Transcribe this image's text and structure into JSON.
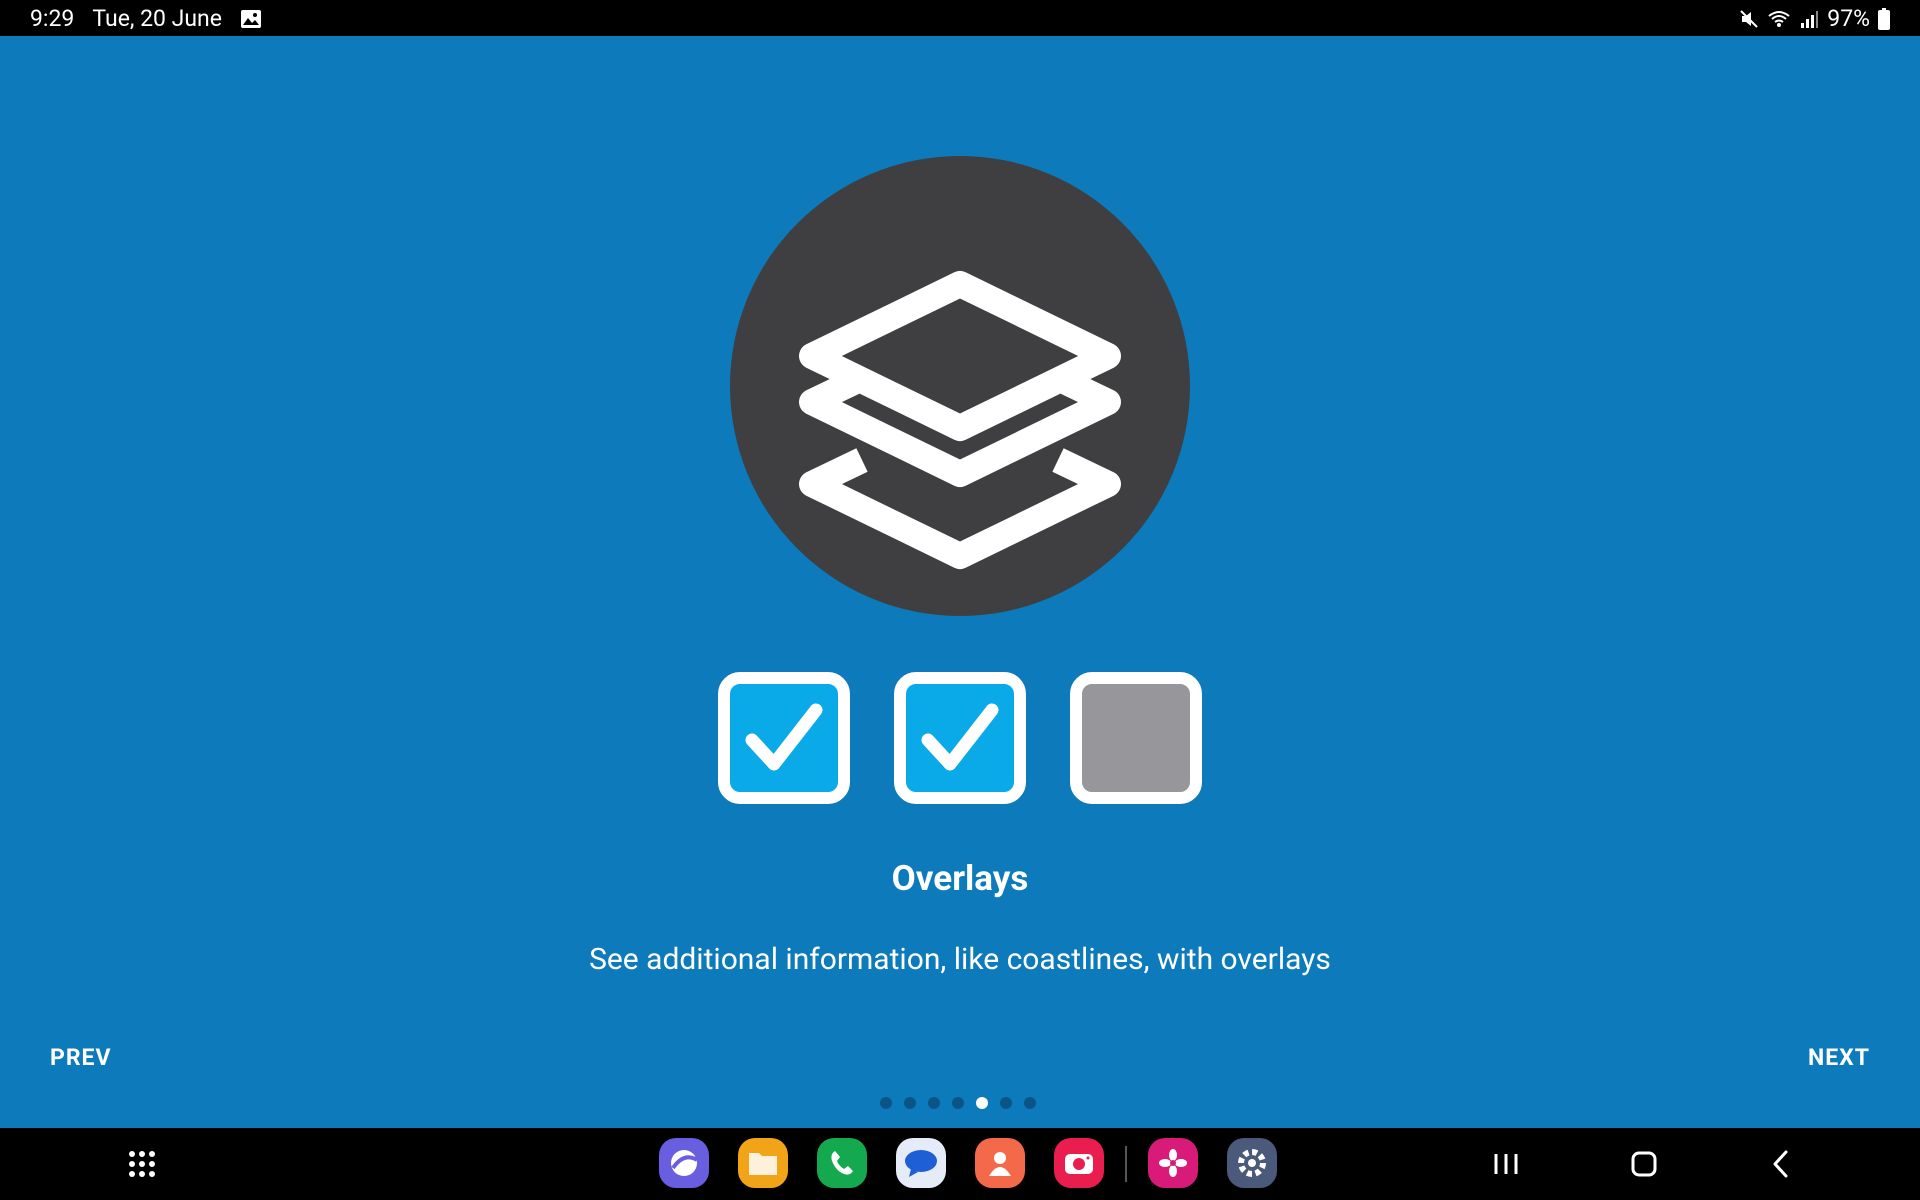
{
  "status_bar": {
    "time": "9:29",
    "date": "Tue, 20 June",
    "battery": "97%",
    "icons": [
      "gallery-notification-icon",
      "mute-icon",
      "wifi-icon",
      "signal-icon",
      "battery-icon"
    ]
  },
  "onboarding": {
    "title": "Overlays",
    "description": "See additional information, like coastlines, with overlays",
    "prev_label": "PREV",
    "next_label": "NEXT",
    "hero_icon": "layers-icon",
    "checkboxes": [
      {
        "checked": true
      },
      {
        "checked": true
      },
      {
        "checked": false
      }
    ],
    "page_count": 7,
    "current_page": 5
  },
  "colors": {
    "background": "#0d7bbb",
    "circle": "#3f3f42",
    "checkbox_checked": "#0aaae8",
    "checkbox_unchecked": "#97979b",
    "dot_inactive": "#0a5586",
    "dot_active": "#ffffff"
  },
  "dock": {
    "apps": [
      {
        "name": "internet-app-icon",
        "color": "#6a5ee0"
      },
      {
        "name": "files-app-icon",
        "color": "#f1a417"
      },
      {
        "name": "phone-app-icon",
        "color": "#14a84f"
      },
      {
        "name": "messages-app-icon",
        "color": "#e6ecf7"
      },
      {
        "name": "contacts-app-icon",
        "color": "#f4694a"
      },
      {
        "name": "camera-app-icon",
        "color": "#e91e4f"
      },
      {
        "name": "bixby-app-icon",
        "color": "#d81b78"
      },
      {
        "name": "settings-app-icon",
        "color": "#4b5a7a"
      }
    ]
  }
}
